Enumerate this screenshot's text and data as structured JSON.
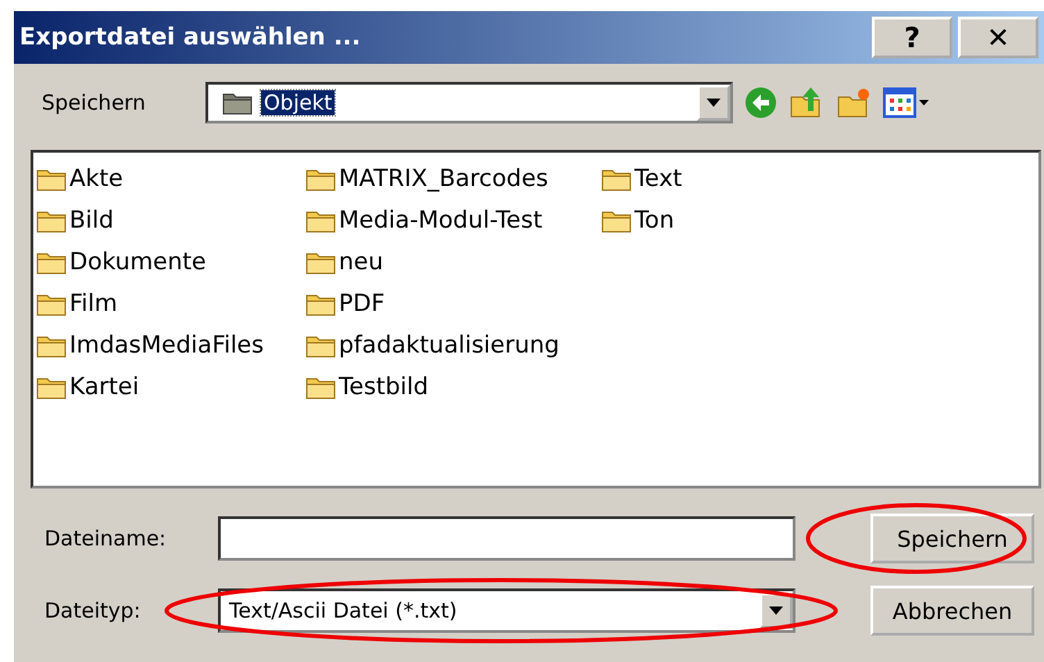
{
  "window": {
    "title": "Exportdatei auswählen ...",
    "buttons": [
      "?",
      "✕"
    ]
  },
  "location": {
    "label": "Speichern",
    "value": "Objekt"
  },
  "files": [
    {
      "name": "Akte"
    },
    {
      "name": "Bild"
    },
    {
      "name": "Dokumente"
    },
    {
      "name": "Film"
    },
    {
      "name": "ImdasMediaFiles"
    },
    {
      "name": "Kartei"
    },
    {
      "name": "MATRIX_Barcodes"
    },
    {
      "name": "Media-Modul-Test"
    },
    {
      "name": "neu"
    },
    {
      "name": "PDF"
    },
    {
      "name": "pfadaktualisierung"
    },
    {
      "name": "Testbild"
    },
    {
      "name": "Text"
    },
    {
      "name": "Ton"
    }
  ],
  "filename": {
    "label": "Dateiname:"
  },
  "filetype": {
    "label": "Dateityp:",
    "value": "Text/Ascii Datei (*.txt)",
    "highlighted": true
  },
  "buttons": [
    {
      "label": "Speichern",
      "highlighted": true
    },
    {
      "label": "Abbrechen",
      "highlighted": false
    }
  ]
}
